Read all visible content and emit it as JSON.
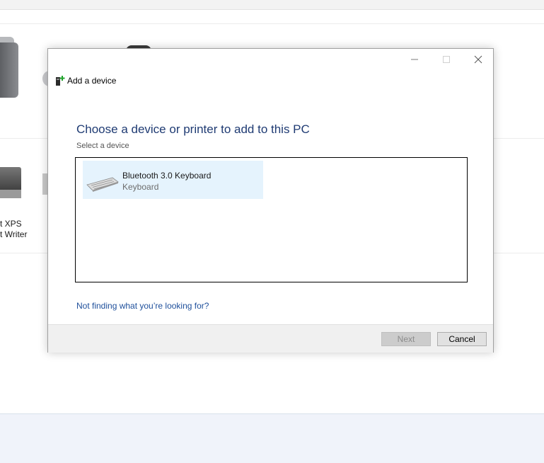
{
  "background": {
    "label_line1": "t XPS",
    "label_line2": "t Writer"
  },
  "dialog": {
    "title": "Add a device",
    "heading": "Choose a device or printer to add to this PC",
    "subheading": "Select a device",
    "devices": [
      {
        "name": "Bluetooth 3.0 Keyboard",
        "type": "Keyboard",
        "icon": "keyboard-icon"
      }
    ],
    "help_link": "Not finding what you’re looking for?",
    "next_label": "Next",
    "cancel_label": "Cancel"
  },
  "colors": {
    "heading": "#1f3b73",
    "link": "#1e4f9b",
    "selection": "#e5f3fd"
  }
}
